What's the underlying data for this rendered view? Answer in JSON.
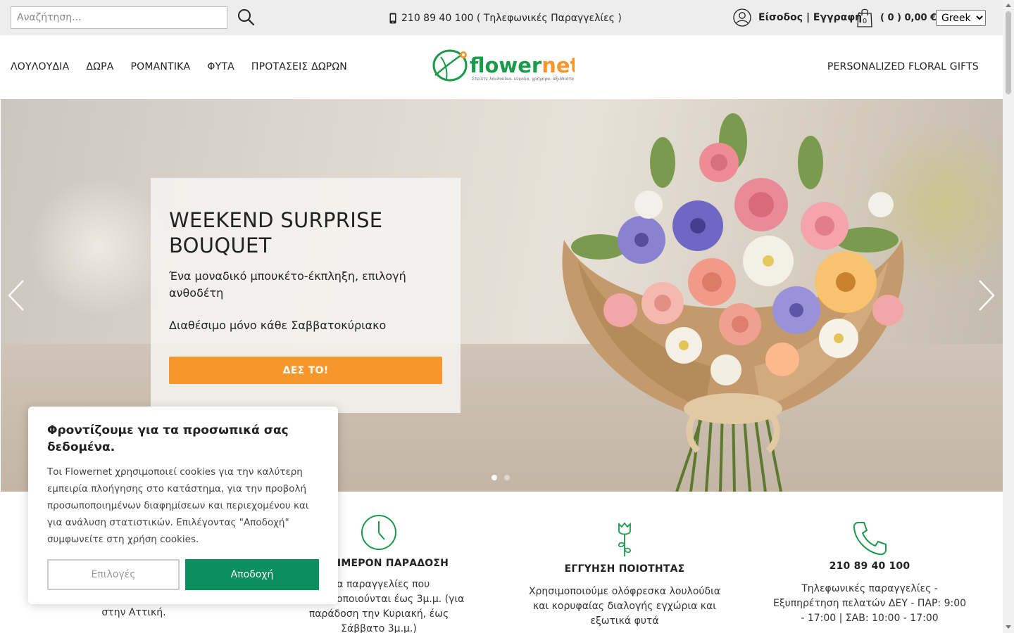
{
  "topbar": {
    "search_placeholder": "Αναζήτηση...",
    "phone": "210 89 40 100 ( Τηλεφωνικές Παραγγελίες )",
    "account_label": "Είσοδος | Εγγραφή",
    "cart_count_label": "( 0 ) 0,00 €",
    "cart_badge": "0",
    "language": "Greek"
  },
  "nav": {
    "items": [
      "ΛΟΥΛΟΥΔΙΑ",
      "ΔΩΡΑ",
      "ΡΟΜΑΝΤΙΚΑ",
      "ΦΥΤΑ",
      "ΠΡΟΤΑΣΕΙΣ ΔΩΡΩΝ"
    ],
    "right_link": "PERSONALIZED FLORAL GIFTS"
  },
  "logo": {
    "text": "flowernet",
    "tagline": "Στείλτε λουλούδια, εύκολα, γρήγορα, αξιόπιστα"
  },
  "hero": {
    "title": "WEEKEND SURPRISE BOUQUET",
    "subtitle": "Ένα μοναδικό μπουκέτο-έκπληξη, επιλογή ανθοδέτη",
    "subtitle2": "Διαθέσιμο μόνο κάθε Σαββατοκύριακο",
    "cta": "ΔΕΣ ΤΟ!",
    "slides_total": 2,
    "slide_active": 1
  },
  "features": [
    {
      "icon": "truck-icon",
      "title": "",
      "text": "στην Αττική."
    },
    {
      "icon": "clock-icon",
      "title": "ΑΥΘΗΜΕΡΟΝ ΠΑΡΑΔΟΣΗ",
      "text": "Για παραγγελίες που πραγματοποιούνται έως 3μ.μ. (για παράδοση την Κυριακή, έως Σάββατο 3μ.μ.)"
    },
    {
      "icon": "rose-icon",
      "title": "ΕΓΓΥΗΣΗ ΠΟΙΟΤΗΤΑΣ",
      "text": "Χρησιμοποιούμε ολόφρεσκα λουλούδια και κορυφαίας διαλογής εγχώρια και εξωτικά φυτά"
    },
    {
      "icon": "phone-icon",
      "title": "210 89 40 100",
      "text": "Τηλεφωνικές παραγγελίες - Εξυπηρέτηση πελατών ΔΕΥ - ΠΑΡ: 9:00 - 17:00 | ΣΑΒ: 10:00 - 17:00"
    }
  ],
  "cookie": {
    "title": "Φροντίζουμε για τα προσωπικά σας δεδομένα.",
    "text": "Τοι Flowernet χρησιμοποιεί cookies για την καλύτερη εμπειρία πλοήγησης στο κατάστημα, για την προβολή προσωποποιημένων διαφημίσεων και περιεχομένου και για ανάλυση στατιστικών. Επιλέγοντας \"Αποδοχή\" συμφωνείτε στη χρήση cookies.",
    "options_label": "Επιλογές",
    "accept_label": "Αποδοχή"
  },
  "colors": {
    "accent_orange": "#f7962a",
    "accept_green": "#0b8f5e",
    "icon_green": "#1a9a4a"
  }
}
